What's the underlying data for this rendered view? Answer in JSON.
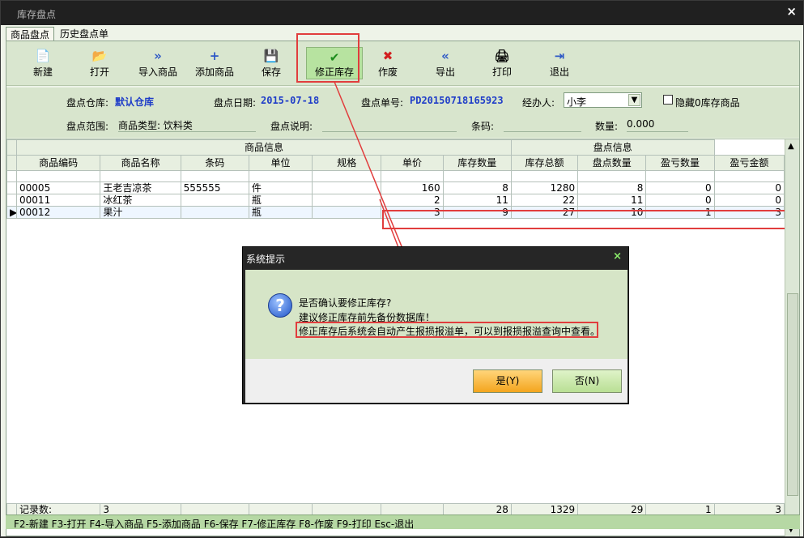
{
  "window": {
    "title": "库存盘点",
    "close": "×"
  },
  "tabs": [
    "商品盘点",
    "历史盘点单"
  ],
  "toolbar": [
    {
      "label": "新建",
      "icon": "📄"
    },
    {
      "label": "打开",
      "icon": "📂"
    },
    {
      "label": "导入商品",
      "icon": "»"
    },
    {
      "label": "添加商品",
      "icon": "+"
    },
    {
      "label": "保存",
      "icon": "💾"
    },
    {
      "label": "修正库存",
      "icon": "✔"
    },
    {
      "label": "作废",
      "icon": "✖"
    },
    {
      "label": "导出",
      "icon": "«"
    },
    {
      "label": "打印",
      "icon": "🖨"
    },
    {
      "label": "退出",
      "icon": "⇥"
    }
  ],
  "form": {
    "warehouse_label": "盘点仓库:",
    "warehouse_value": "默认仓库",
    "date_label": "盘点日期:",
    "date_value": "2015-07-18",
    "order_label": "盘点单号:",
    "order_value": "PD20150718165923",
    "operator_label": "经办人:",
    "operator_value": "小李",
    "hide_zero_label": "隐藏0库存商品",
    "range_label": "盘点范围:",
    "range_value": "商品类型: 饮料类",
    "desc_label": "盘点说明:",
    "desc_value": "",
    "barcode_label": "条码:",
    "barcode_value": "",
    "qty_label": "数量:",
    "qty_value": "0.000"
  },
  "grid": {
    "group_headers": [
      "商品信息",
      "盘点信息"
    ],
    "columns": [
      "商品编码",
      "商品名称",
      "条码",
      "单位",
      "规格",
      "单价",
      "库存数量",
      "库存总额",
      "盘点数量",
      "盈亏数量",
      "盈亏金额"
    ],
    "rows": [
      [
        "00005",
        "王老吉凉茶",
        "555555",
        "件",
        "",
        "160",
        "8",
        "1280",
        "8",
        "0",
        "0"
      ],
      [
        "00011",
        "冰红茶",
        "",
        "瓶",
        "",
        "2",
        "11",
        "22",
        "11",
        "0",
        "0"
      ],
      [
        "00012",
        "果汁",
        "",
        "瓶",
        "",
        "3",
        "9",
        "27",
        "10",
        "1",
        "3"
      ]
    ],
    "footer": {
      "label": "记录数:",
      "count": "3",
      "stock_qty": "28",
      "stock_total": "1329",
      "check_qty": "29",
      "profit_qty": "1",
      "profit_amount": "3"
    }
  },
  "statusbar": "F2-新建 F3-打开 F4-导入商品 F5-添加商品 F6-保存 F7-修正库存 F8-作废 F9-打印 Esc-退出",
  "dialog": {
    "title": "系统提示",
    "close": "×",
    "line1": "是否确认要修正库存?",
    "line2": "建议修正库存前先备份数据库！",
    "line3": "修正库存后系统会自动产生报损报溢单，可以到报损报溢查询中查看。",
    "yes": "是(Y)",
    "no": "否(N)"
  },
  "colors": {
    "accent": "#e13d3d",
    "warehouse_blue": "#1f3dc8"
  }
}
